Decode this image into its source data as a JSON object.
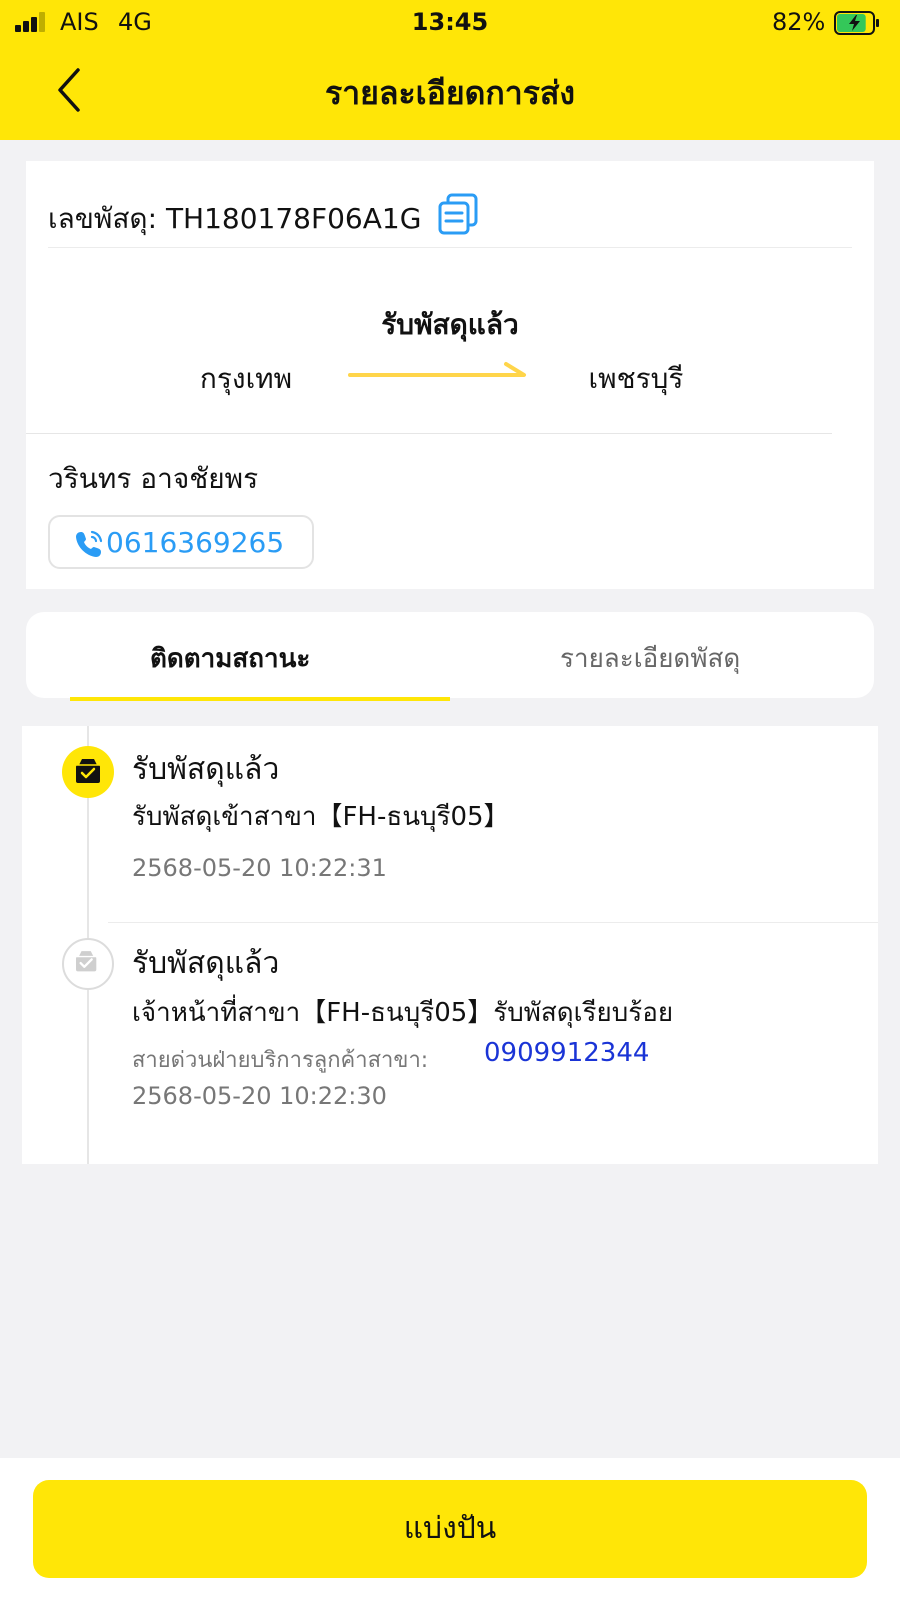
{
  "status_bar": {
    "carrier": "AIS",
    "network": "4G",
    "time": "13:45",
    "battery_percent": "82%",
    "battery_level": 0.82
  },
  "header": {
    "title": "รายละเอียดการส่ง",
    "back_icon": "chevron-left-icon"
  },
  "parcel": {
    "tracking_label": "เลขพัสดุ:",
    "tracking_number": "TH180178F06A1G",
    "copy_icon": "copy-icon",
    "status": "รับพัสดุแล้ว",
    "origin": "กรุงเทพ",
    "destination": "เพชรบุรี",
    "receiver_name": "วรินทร อาจชัยพร",
    "receiver_phone": "0616369265",
    "phone_icon": "phone-call-icon"
  },
  "tabs": [
    {
      "label": "ติดตามสถานะ",
      "active": true
    },
    {
      "label": "รายละเอียดพัสดุ",
      "active": false
    }
  ],
  "timeline": [
    {
      "title": "รับพัสดุแล้ว",
      "description": "รับพัสดุเข้าสาขา【FH-ธนบุรี05】",
      "time": "2568-05-20 10:22:31",
      "icon": "package-check-icon"
    },
    {
      "title": "รับพัสดุแล้ว",
      "description": "เจ้าหน้าที่สาขา【FH-ธนบุรี05】รับพัสดุเรียบร้อย",
      "hotline_label": "สายด่วนฝ่ายบริการลูกค้าสาขา:",
      "hotline_number": "0909912344",
      "time": "2568-05-20 10:22:30",
      "icon": "package-check-icon"
    }
  ],
  "share_button": "แบ่งปัน",
  "colors": {
    "brand_yellow": "#ffe607",
    "link_blue": "#2a9cf5",
    "hotline_blue": "#1a34d6"
  }
}
